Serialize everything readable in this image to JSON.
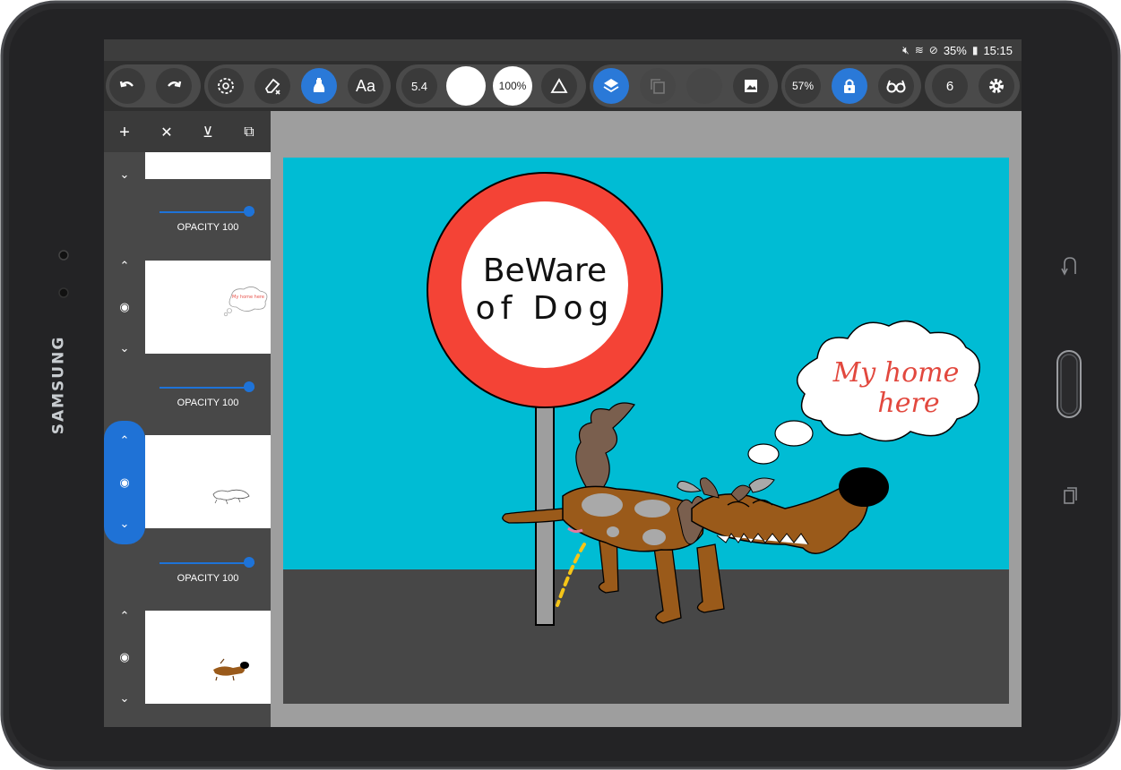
{
  "device": {
    "brand": "SAMSUNG"
  },
  "status_bar": {
    "battery": "35%",
    "time": "15:15"
  },
  "toolbar": {
    "brush_size": "5.4",
    "opacity": "100%",
    "zoom": "57%",
    "frame_count": "6",
    "text_tool_label": "Aa"
  },
  "layers": [
    {
      "opacity_label": "OPACITY 100"
    },
    {
      "opacity_label": "OPACITY 100",
      "thumb_text": "My home here"
    },
    {
      "opacity_label": "OPACITY 100"
    },
    {}
  ],
  "canvas": {
    "sign_text_line1": "BeWare",
    "sign_text_line2": "of Dog",
    "bubble_line1": "My home",
    "bubble_line2": "here"
  },
  "colors": {
    "sky": "#00bcd4",
    "ground": "#474747",
    "sign_red": "#f44336",
    "accent_blue": "#2a79d8"
  }
}
